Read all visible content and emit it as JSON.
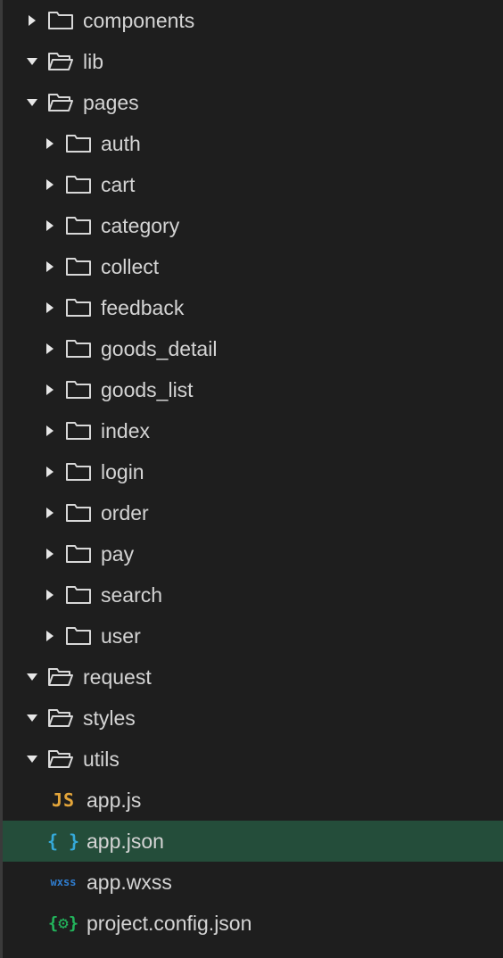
{
  "tree": [
    {
      "label": "components",
      "kind": "folder",
      "expanded": false,
      "depth": 0
    },
    {
      "label": "lib",
      "kind": "folder",
      "expanded": true,
      "depth": 0
    },
    {
      "label": "pages",
      "kind": "folder",
      "expanded": true,
      "depth": 0
    },
    {
      "label": "auth",
      "kind": "folder",
      "expanded": false,
      "depth": 1
    },
    {
      "label": "cart",
      "kind": "folder",
      "expanded": false,
      "depth": 1
    },
    {
      "label": "category",
      "kind": "folder",
      "expanded": false,
      "depth": 1
    },
    {
      "label": "collect",
      "kind": "folder",
      "expanded": false,
      "depth": 1
    },
    {
      "label": "feedback",
      "kind": "folder",
      "expanded": false,
      "depth": 1
    },
    {
      "label": "goods_detail",
      "kind": "folder",
      "expanded": false,
      "depth": 1
    },
    {
      "label": "goods_list",
      "kind": "folder",
      "expanded": false,
      "depth": 1
    },
    {
      "label": "index",
      "kind": "folder",
      "expanded": false,
      "depth": 1
    },
    {
      "label": "login",
      "kind": "folder",
      "expanded": false,
      "depth": 1
    },
    {
      "label": "order",
      "kind": "folder",
      "expanded": false,
      "depth": 1
    },
    {
      "label": "pay",
      "kind": "folder",
      "expanded": false,
      "depth": 1
    },
    {
      "label": "search",
      "kind": "folder",
      "expanded": false,
      "depth": 1
    },
    {
      "label": "user",
      "kind": "folder",
      "expanded": false,
      "depth": 1
    },
    {
      "label": "request",
      "kind": "folder",
      "expanded": true,
      "depth": 0
    },
    {
      "label": "styles",
      "kind": "folder",
      "expanded": true,
      "depth": 0
    },
    {
      "label": "utils",
      "kind": "folder",
      "expanded": true,
      "depth": 0
    },
    {
      "label": "app.js",
      "kind": "file",
      "icon": "js-file-icon",
      "icon_text": "JS",
      "depth": 0
    },
    {
      "label": "app.json",
      "kind": "file",
      "icon": "json-file-icon",
      "icon_text": "{ }",
      "depth": 0,
      "selected": true
    },
    {
      "label": "app.wxss",
      "kind": "file",
      "icon": "wxss-file-icon",
      "icon_text": "wxss",
      "depth": 0
    },
    {
      "label": "project.config.json",
      "kind": "file",
      "icon": "config-file-icon",
      "icon_text": "{⚙}",
      "depth": 0
    }
  ],
  "colors": {
    "background": "#1e1e1e",
    "text": "#d4d4d4",
    "selected_row": "#244d3a",
    "js_icon": "#e3a53a",
    "json_icon": "#35a9d9",
    "wxss_icon": "#2f7dcf",
    "config_icon": "#22b55c"
  }
}
